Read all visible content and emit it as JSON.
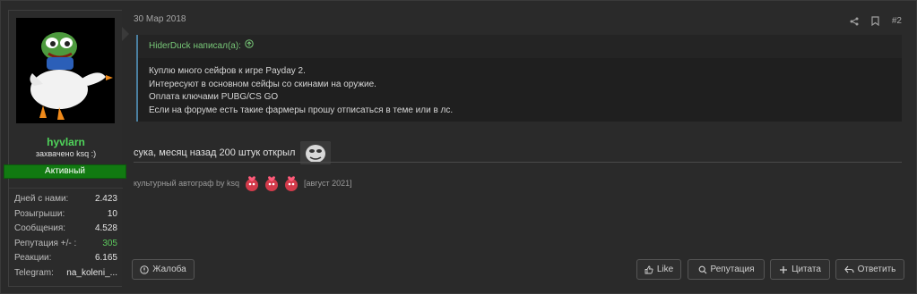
{
  "user": {
    "name": "hyvlarn",
    "title": "захвачено ksq :)",
    "status": "Активный",
    "stats": [
      {
        "label": "Дней с нами:",
        "value": "2.423"
      },
      {
        "label": "Розыгрыши:",
        "value": "10"
      },
      {
        "label": "Сообщения:",
        "value": "4.528"
      },
      {
        "label": "Репутация +/- :",
        "value": "305"
      },
      {
        "label": "Реакции:",
        "value": "6.165"
      },
      {
        "label": "Telegram:",
        "value": "na_koleni_..."
      }
    ]
  },
  "post": {
    "date": "30 Мар 2018",
    "number": "#2",
    "quote": {
      "author_line": "HiderDuck написал(а):",
      "lines": [
        "Куплю много сейфов к игре Payday 2.",
        "Интересуют в основном сейфы со скинами на оружие.",
        "Оплата ключами PUBG/CS GO",
        "Если на форуме есть такие фармеры прошу отписаться в теме или в лс."
      ]
    },
    "message": "сука, месяц назад 200 штук открыл",
    "signature": {
      "text": "культурный автограф by ksq",
      "date": "[август 2021]"
    }
  },
  "buttons": {
    "report": "Жалоба",
    "like": "Like",
    "reputation": "Репутация",
    "quote": "Цитата",
    "reply": "Ответить"
  },
  "colors": {
    "username": "#4fd35a",
    "status_badge": "#117a11",
    "quote_author": "#78c878"
  },
  "icons": [
    "share-icon",
    "bookmark-icon",
    "arrow-up-circle-icon",
    "alert-circle-icon",
    "thumbs-up-icon",
    "search-icon",
    "plus-icon",
    "reply-icon"
  ]
}
